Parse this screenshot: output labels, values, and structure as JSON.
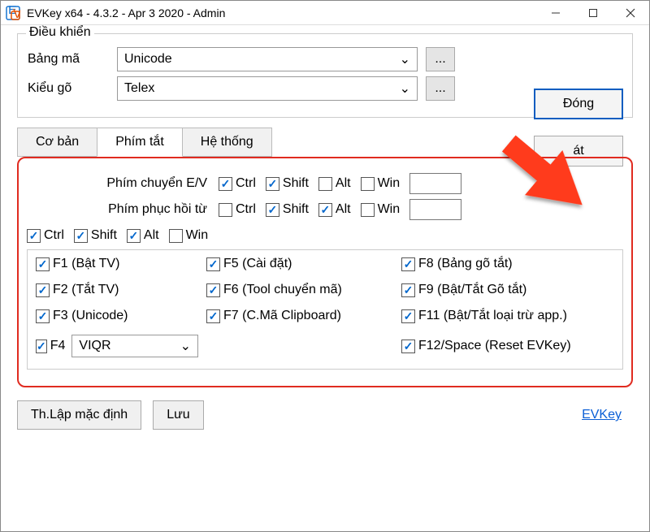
{
  "title": "EVKey x64 - 4.3.2 - Apr  3 2020 - Admin",
  "control_group": {
    "title": "Điều khiển",
    "bangma_label": "Bảng mã",
    "bangma_value": "Unicode",
    "kieugo_label": "Kiểu gõ",
    "kieugo_value": "Telex",
    "dots": "...",
    "close_btn": "Đóng",
    "exit_btn": "  át"
  },
  "tabs": {
    "basic": "Cơ bản",
    "shortcut": "Phím tắt",
    "system": "Hệ thống"
  },
  "shortcut": {
    "ev_label": "Phím chuyển E/V",
    "restore_label": "Phím phục hồi từ",
    "mods": {
      "ctrl": "Ctrl",
      "shift": "Shift",
      "alt": "Alt",
      "win": "Win"
    },
    "fn": {
      "f1": "F1 (Bật TV)",
      "f2": "F2 (Tắt TV)",
      "f3": "F3 (Unicode)",
      "f4": "F4",
      "f5": "F5 (Cài đặt)",
      "f6": "F6 (Tool chuyển mã)",
      "f7": "F7 (C.Mã Clipboard)",
      "f8": "F8 (Bảng gõ tắt)",
      "f9": "F9 (Bật/Tắt Gõ tắt)",
      "f11": "F11 (Bật/Tắt loại trừ app.)",
      "f12": "F12/Space (Reset EVKey)"
    },
    "f4_select": "VIQR"
  },
  "bottom": {
    "default_btn": "Th.Lập mặc định",
    "save_btn": "Lưu",
    "link": "EVKey"
  }
}
